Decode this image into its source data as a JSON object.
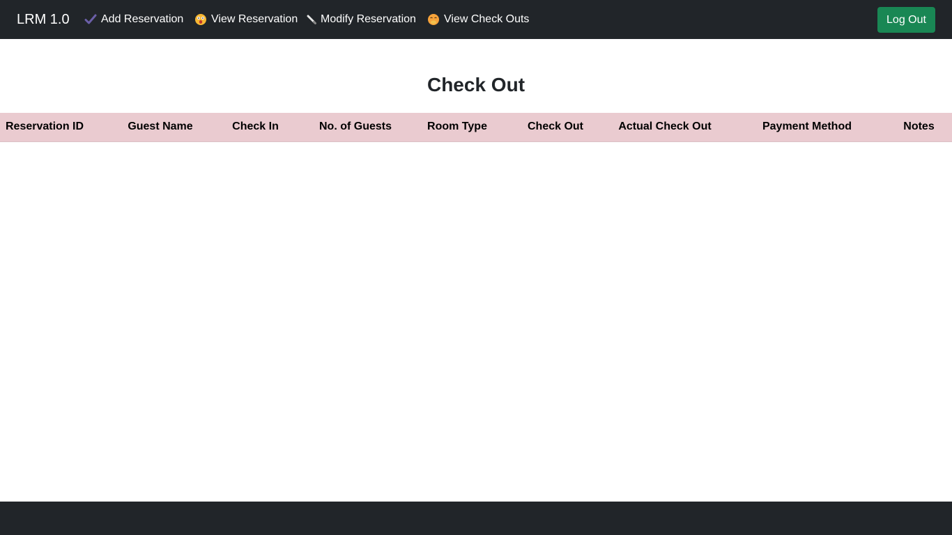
{
  "navbar": {
    "brand": "LRM 1.0",
    "items": [
      {
        "label": "Add Reservation",
        "icon": "check-icon"
      },
      {
        "label": "View Reservation",
        "icon": "shocked-face-icon"
      },
      {
        "label": "Modify Reservation",
        "icon": "pencil-icon"
      },
      {
        "label": "View Check Outs",
        "icon": "hand-over-mouth-face-icon"
      }
    ],
    "logout_label": "Log Out"
  },
  "colors": {
    "navbar_bg": "#212529",
    "logout_bg": "#198754",
    "table_header_bg": "#eacbd0"
  },
  "page": {
    "title": "Check Out"
  },
  "table": {
    "columns": [
      "Reservation ID",
      "Guest Name",
      "Check In",
      "No. of Guests",
      "Room Type",
      "Check Out",
      "Actual Check Out",
      "Payment Method",
      "Notes"
    ],
    "rows": []
  }
}
